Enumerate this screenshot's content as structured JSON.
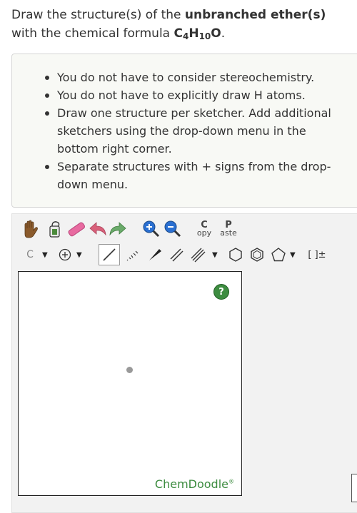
{
  "question": {
    "prefix": "Draw the structure(s) of the ",
    "bold": "unbranched ether(s)",
    "mid": " with the chemical formula ",
    "formula": {
      "c": "C",
      "c_sub": "4",
      "h": "H",
      "h_sub": "10",
      "o": "O"
    },
    "suffix": "."
  },
  "instructions": [
    "You do not have to consider stereochemistry.",
    "You do not have to explicitly draw H atoms.",
    "Draw one structure per sketcher. Add additional sketchers using the drop-down menu in the bottom right corner.",
    "Separate structures with + signs from the drop-down menu."
  ],
  "toolbar": {
    "copy": {
      "big": "C",
      "small": "opy"
    },
    "paste": {
      "big": "P",
      "small": "aste"
    },
    "atom_label": "C",
    "bracket_label": "[ ]±"
  },
  "canvas": {
    "help": "?",
    "brand": "ChemDoodle",
    "brand_mark": "®"
  },
  "colors": {
    "brand": "#3d8c40",
    "box_bg": "#f8f9f5",
    "toolbar_bg": "#f2f2f2"
  }
}
